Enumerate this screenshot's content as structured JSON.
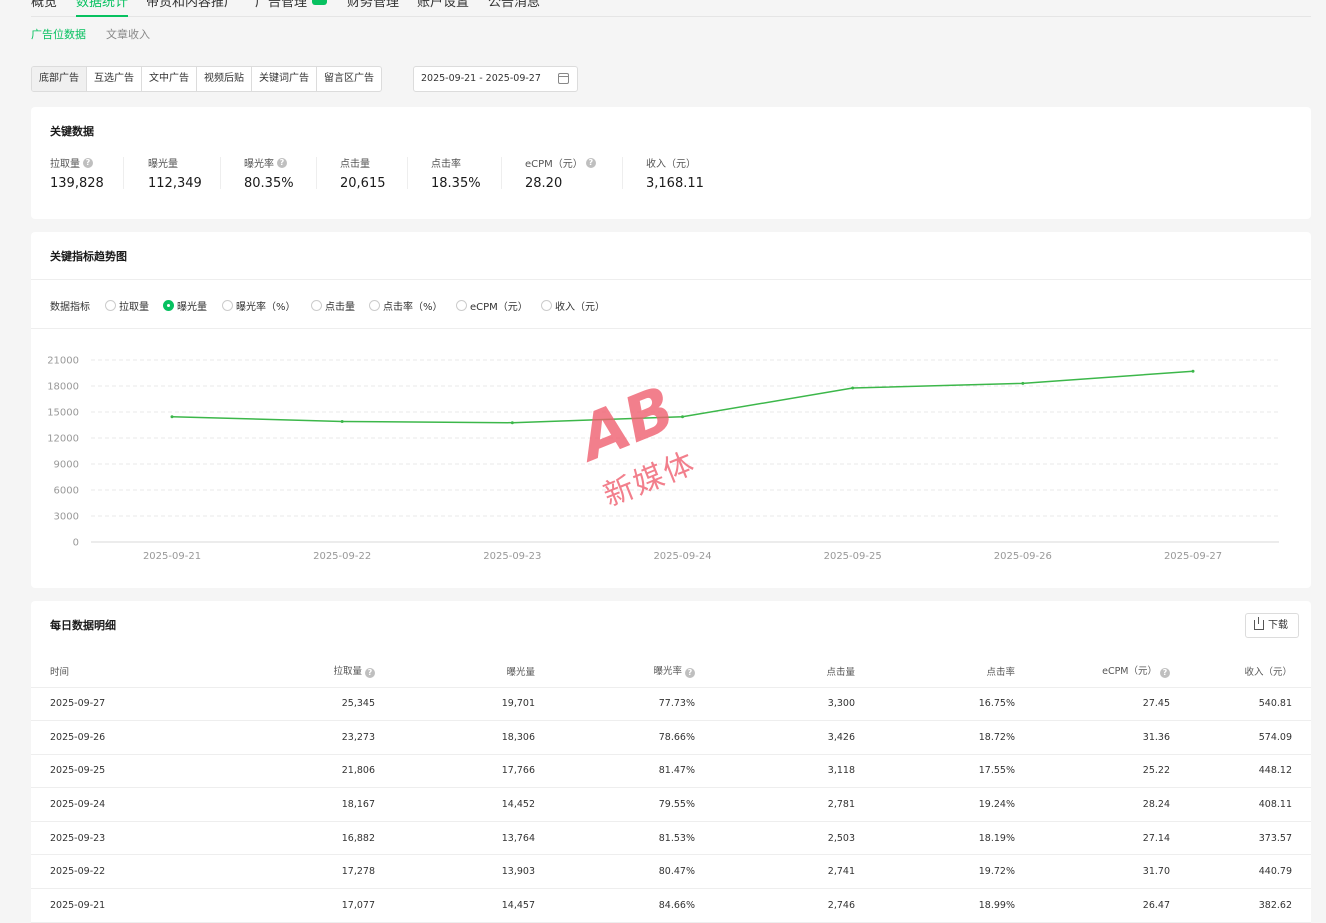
{
  "topnav": [
    {
      "label": "概览",
      "active": false
    },
    {
      "label": "数据统计",
      "active": true
    },
    {
      "label": "带货和内容推广",
      "active": false
    },
    {
      "label": "广告管理",
      "active": false
    },
    {
      "label": "财务管理",
      "active": false
    },
    {
      "label": "账户设置",
      "active": false
    },
    {
      "label": "公告消息",
      "active": false
    }
  ],
  "subtabs": [
    {
      "label": "广告位数据",
      "active": true
    },
    {
      "label": "文章收入",
      "active": false
    }
  ],
  "ad_types": [
    {
      "label": "底部广告",
      "active": true
    },
    {
      "label": "互选广告",
      "active": false
    },
    {
      "label": "文中广告",
      "active": false
    },
    {
      "label": "视频后贴",
      "active": false
    },
    {
      "label": "关键词广告",
      "active": false
    },
    {
      "label": "留言区广告",
      "active": false
    }
  ],
  "date_range": "2025-09-21 - 2025-09-27",
  "key_data": {
    "title": "关键数据",
    "items": [
      {
        "label": "拉取量",
        "value": "139,828",
        "help": true
      },
      {
        "label": "曝光量",
        "value": "112,349",
        "help": false
      },
      {
        "label": "曝光率",
        "value": "80.35%",
        "help": true
      },
      {
        "label": "点击量",
        "value": "20,615",
        "help": false
      },
      {
        "label": "点击率",
        "value": "18.35%",
        "help": false
      },
      {
        "label": "eCPM（元）",
        "value": "28.20",
        "help": true
      },
      {
        "label": "收入（元）",
        "value": "3,168.11",
        "help": false
      }
    ]
  },
  "trend": {
    "title": "关键指标趋势图",
    "metric_label": "数据指标",
    "metrics": [
      {
        "label": "拉取量",
        "selected": false
      },
      {
        "label": "曝光量",
        "selected": true
      },
      {
        "label": "曝光率（%）",
        "selected": false
      },
      {
        "label": "点击量",
        "selected": false
      },
      {
        "label": "点击率（%）",
        "selected": false
      },
      {
        "label": "eCPM（元）",
        "selected": false
      },
      {
        "label": "收入（元）",
        "selected": false
      }
    ]
  },
  "chart_data": {
    "type": "line",
    "x": [
      "2025-09-21",
      "2025-09-22",
      "2025-09-23",
      "2025-09-24",
      "2025-09-25",
      "2025-09-26",
      "2025-09-27"
    ],
    "series": [
      {
        "values": [
          14457,
          13903,
          13764,
          14452,
          17766,
          18306,
          19701
        ]
      }
    ],
    "yticks": [
      0,
      3000,
      6000,
      9000,
      12000,
      15000,
      18000,
      21000
    ],
    "ylim": [
      0,
      21000
    ],
    "grid": true,
    "color": "#3cb74a"
  },
  "daily": {
    "title": "每日数据明细",
    "download_label": "下载",
    "columns": [
      {
        "label": "时间",
        "help": false
      },
      {
        "label": "拉取量",
        "help": true
      },
      {
        "label": "曝光量",
        "help": false
      },
      {
        "label": "曝光率",
        "help": true
      },
      {
        "label": "点击量",
        "help": false
      },
      {
        "label": "点击率",
        "help": false
      },
      {
        "label": "eCPM（元）",
        "help": true
      },
      {
        "label": "收入（元）",
        "help": false
      }
    ],
    "rows": [
      [
        "2025-09-27",
        "25,345",
        "19,701",
        "77.73%",
        "3,300",
        "16.75%",
        "27.45",
        "540.81"
      ],
      [
        "2025-09-26",
        "23,273",
        "18,306",
        "78.66%",
        "3,426",
        "18.72%",
        "31.36",
        "574.09"
      ],
      [
        "2025-09-25",
        "21,806",
        "17,766",
        "81.47%",
        "3,118",
        "17.55%",
        "25.22",
        "448.12"
      ],
      [
        "2025-09-24",
        "18,167",
        "14,452",
        "79.55%",
        "2,781",
        "19.24%",
        "28.24",
        "408.11"
      ],
      [
        "2025-09-23",
        "16,882",
        "13,764",
        "81.53%",
        "2,503",
        "18.19%",
        "27.14",
        "373.57"
      ],
      [
        "2025-09-22",
        "17,278",
        "13,903",
        "80.47%",
        "2,741",
        "19.72%",
        "31.70",
        "440.79"
      ],
      [
        "2025-09-21",
        "17,077",
        "14,457",
        "84.66%",
        "2,746",
        "18.99%",
        "26.47",
        "382.62"
      ]
    ]
  },
  "watermark": {
    "logo": "AB",
    "text": "新媒体"
  }
}
